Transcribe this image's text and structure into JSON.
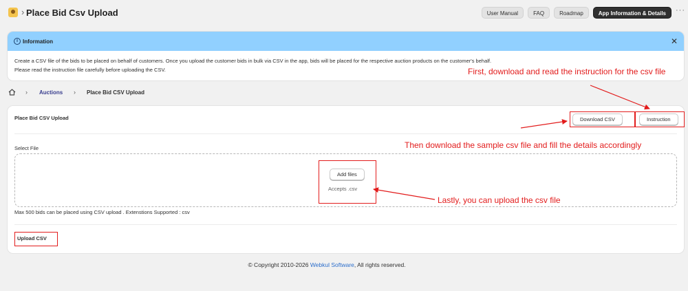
{
  "header": {
    "title": "Place Bid Csv Upload",
    "buttons": [
      "User Manual",
      "FAQ",
      "Roadmap",
      "App Information & Details"
    ],
    "more": "···"
  },
  "info_banner": {
    "title": "Information",
    "line1": "Create a CSV file of the bids to be placed on behalf of customers. Once you upload the customer bids in bulk via CSV in the app, bids will be placed for the respective auction products on the customer's behalf.",
    "line2": "Please read the instruction file carefully before uploading the CSV.",
    "close": "✕"
  },
  "breadcrumb": {
    "link": "Auctions",
    "current": "Place Bid CSV Upload",
    "separator": "›"
  },
  "card": {
    "title": "Place Bid CSV Upload",
    "download_label": "Download CSV",
    "instruction_label": "Instruction",
    "select_file_label": "Select File",
    "add_files_label": "Add files",
    "accepts": "Accepts .csv",
    "helper": "Max 500 bids can be placed using CSV upload . Extenstions Supported : csv",
    "upload_label": "Upload CSV"
  },
  "annotations": {
    "note1": "First, download and read the instruction for the csv file",
    "note2": "Then download the sample csv file and fill the details accordingly",
    "note3": "Lastly, you can upload the csv file",
    "color": "#e21b1b"
  },
  "footer": {
    "prefix": "© Copyright 2010-2026 ",
    "link": "Webkul Software",
    "suffix": ", All rights reserved."
  },
  "colors": {
    "banner": "#91d0ff",
    "dark_button": "#303030",
    "link": "#3a3f8f",
    "page_bg": "#f1f1f1"
  }
}
